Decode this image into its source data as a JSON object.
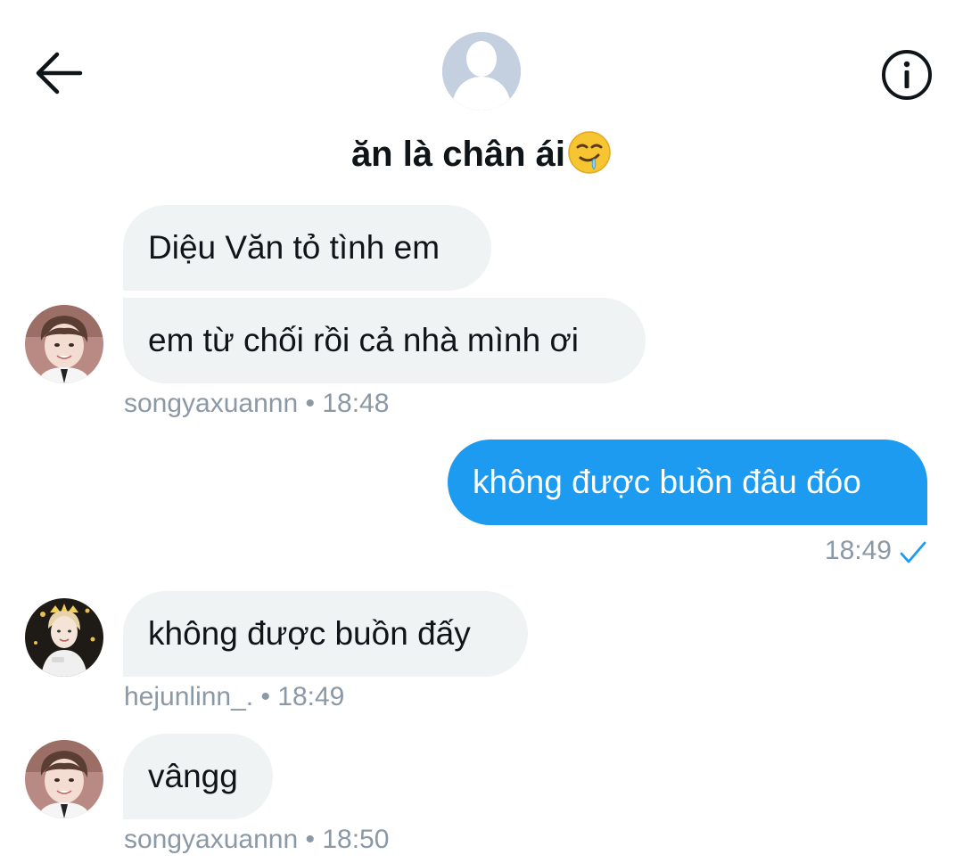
{
  "header": {
    "title": "ăn là chân ái",
    "title_emoji": "drooling-face-emoji",
    "back_icon": "arrow-left-icon",
    "info_icon": "info-icon",
    "group_avatar_icon": "default-profile-silhouette"
  },
  "messages": [
    {
      "direction": "incoming",
      "text": "Diệu Văn tỏ tình em"
    },
    {
      "direction": "incoming",
      "text": "em từ chối rồi cả nhà mình ơi",
      "sender": "songyaxuannn",
      "time": "18:48",
      "meta": "songyaxuannn • 18:48"
    },
    {
      "direction": "outgoing",
      "text": "không được buồn đâu đóo",
      "time": "18:49",
      "meta": "18:49",
      "status_icon": "checkmark-icon"
    },
    {
      "direction": "incoming",
      "text": "không được buồn đấy",
      "sender": "hejunlinn_.",
      "time": "18:49",
      "meta": "hejunlinn_. • 18:49"
    },
    {
      "direction": "incoming",
      "text": "vângg",
      "sender": "songyaxuannn",
      "time": "18:50",
      "meta": "songyaxuannn • 18:50"
    }
  ],
  "colors": {
    "outgoing_bubble": "#1d9bf0",
    "incoming_bubble": "#eff3f4",
    "meta_text": "#8b98a5",
    "checkmark": "#1d9bf0"
  }
}
